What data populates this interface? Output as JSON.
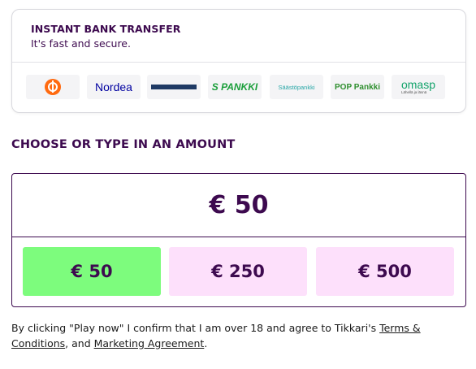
{
  "transfer": {
    "title": "INSTANT BANK TRANSFER",
    "subtitle": "It's fast and secure.",
    "banks": [
      {
        "name": "op-logo",
        "label": ""
      },
      {
        "name": "nordea-logo",
        "label": "Nordea"
      },
      {
        "name": "danske-bank-logo",
        "label": "Danske Bank"
      },
      {
        "name": "s-pankki-logo",
        "label": "S PANKKI"
      },
      {
        "name": "saastopankki-logo",
        "label": "Säästöpankki"
      },
      {
        "name": "pop-pankki-logo",
        "label": "POP Pankki"
      },
      {
        "name": "omasp-logo",
        "label": "omasp",
        "sublabel": "Lähellä ja läsnä"
      }
    ]
  },
  "amount": {
    "heading": "CHOOSE OR TYPE IN AN AMOUNT",
    "input_value": "€ 50",
    "presets": [
      {
        "label": "€ 50",
        "selected": true
      },
      {
        "label": "€ 250",
        "selected": false
      },
      {
        "label": "€ 500",
        "selected": false
      }
    ]
  },
  "consent": {
    "prefix": "By clicking \"Play now\" I confirm that I am over 18 and agree to Tikkari's ",
    "terms_link": "Terms & Conditions",
    "middle": ", and ",
    "marketing_link": "Marketing Agreement",
    "suffix": "."
  },
  "colors": {
    "brand_purple": "#3d0a4f",
    "selected_green": "#7dfc7d",
    "preset_pink": "#fde0fb"
  }
}
